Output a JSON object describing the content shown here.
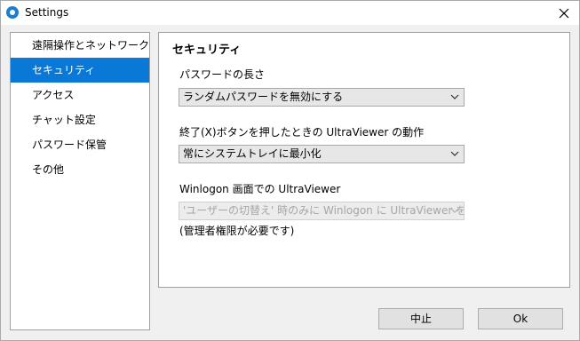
{
  "window": {
    "title": "Settings"
  },
  "sidebar": {
    "items": [
      {
        "label": "遠隔操作とネットワーク"
      },
      {
        "label": "セキュリティ"
      },
      {
        "label": "アクセス"
      },
      {
        "label": "チャット設定"
      },
      {
        "label": "パスワード保管"
      },
      {
        "label": "その他"
      }
    ],
    "active_index": 1
  },
  "panel": {
    "title": "セキュリティ",
    "password_length": {
      "label": "パスワードの長さ",
      "value": "ランダムパスワードを無効にする"
    },
    "close_action": {
      "label": "終了(X)ボタンを押したときの UltraViewer の動作",
      "value": "常にシステムトレイに最小化"
    },
    "winlogon": {
      "label": "Winlogon 画面での UltraViewer",
      "value": "'ユーザーの切替え' 時のみに Winlogon に UltraViewer を表示",
      "note": "(管理者権限が必要です)"
    }
  },
  "footer": {
    "cancel_label": "中止",
    "ok_label": "Ok"
  },
  "colors": {
    "accent": "#0a78d7",
    "app_icon": "#1b7fd1"
  }
}
